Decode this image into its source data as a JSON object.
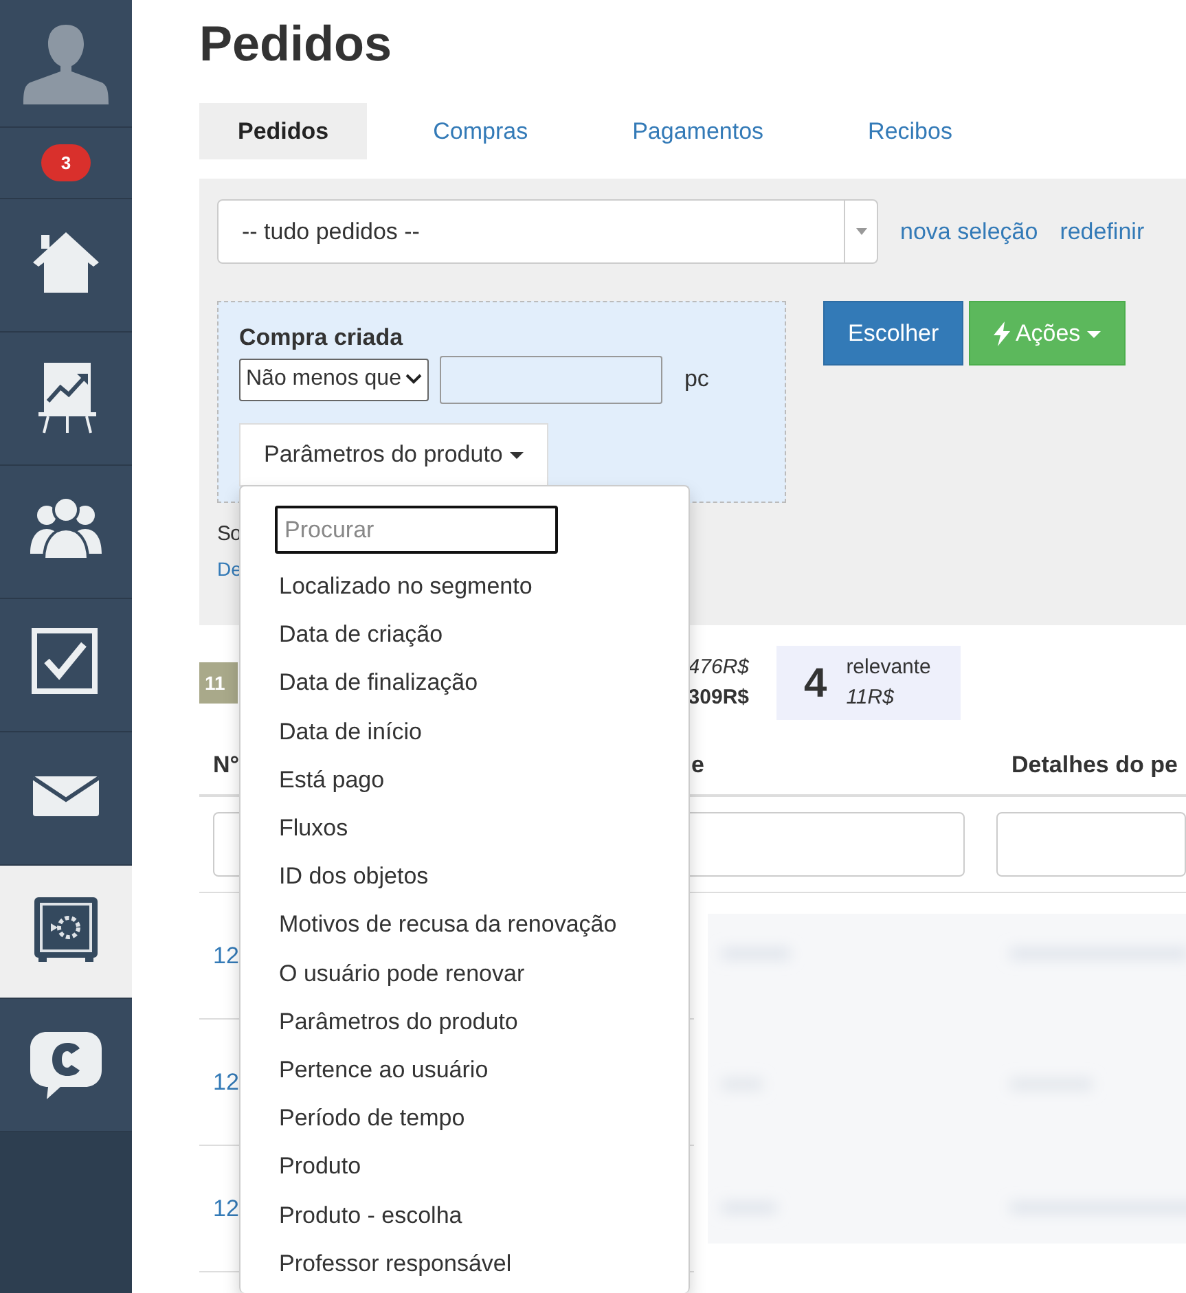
{
  "sidebar": {
    "badge": "3",
    "items": [
      {
        "selected": false
      },
      {
        "selected": false
      },
      {
        "selected": false
      },
      {
        "selected": false
      },
      {
        "selected": false
      },
      {
        "selected": true
      },
      {
        "selected": false
      }
    ]
  },
  "title": "Pedidos",
  "tabs": [
    {
      "label": "Pedidos",
      "selected": true
    },
    {
      "label": "Compras",
      "selected": false
    },
    {
      "label": "Pagamentos",
      "selected": false
    },
    {
      "label": "Recibos",
      "selected": false
    }
  ],
  "filter": {
    "selection": "-- tudo pedidos --",
    "links": [
      "nova seleção",
      "redefinir"
    ],
    "condition": {
      "title": "Compra criada",
      "operator": "Não menos que",
      "unit": "pc",
      "parameter_button": "Parâmetros do produto"
    },
    "buttons": [
      {
        "label": "Escolher",
        "kind": "primary"
      },
      {
        "label": "Ações",
        "kind": "actions"
      }
    ],
    "footer_line_1": "So",
    "footer_line_2": "De"
  },
  "stats": {
    "count_badge": "11",
    "amount_1": "476R$",
    "amount_2": "309R$",
    "relevant": {
      "count": "4",
      "label": "relevante",
      "amount": "11R$"
    }
  },
  "table": {
    "columns": [
      "N°",
      "e",
      "Detalhes do pe"
    ],
    "rows": [
      {
        "column_1": "12"
      },
      {
        "column_1": "12"
      },
      {
        "column_1": "12"
      }
    ]
  },
  "dropdown": {
    "placeholder": "Procurar",
    "items": [
      "Localizado no segmento",
      "Data de criação",
      "Data de finalização",
      "Data de início",
      "Está pago",
      "Fluxos",
      "ID dos objetos",
      "Motivos de recusa da renovação",
      "O usuário pode renovar",
      "Parâmetros do produto",
      "Pertence ao usuário",
      "Período de tempo",
      "Produto",
      "Produto - escolha",
      "Professor responsável"
    ]
  }
}
